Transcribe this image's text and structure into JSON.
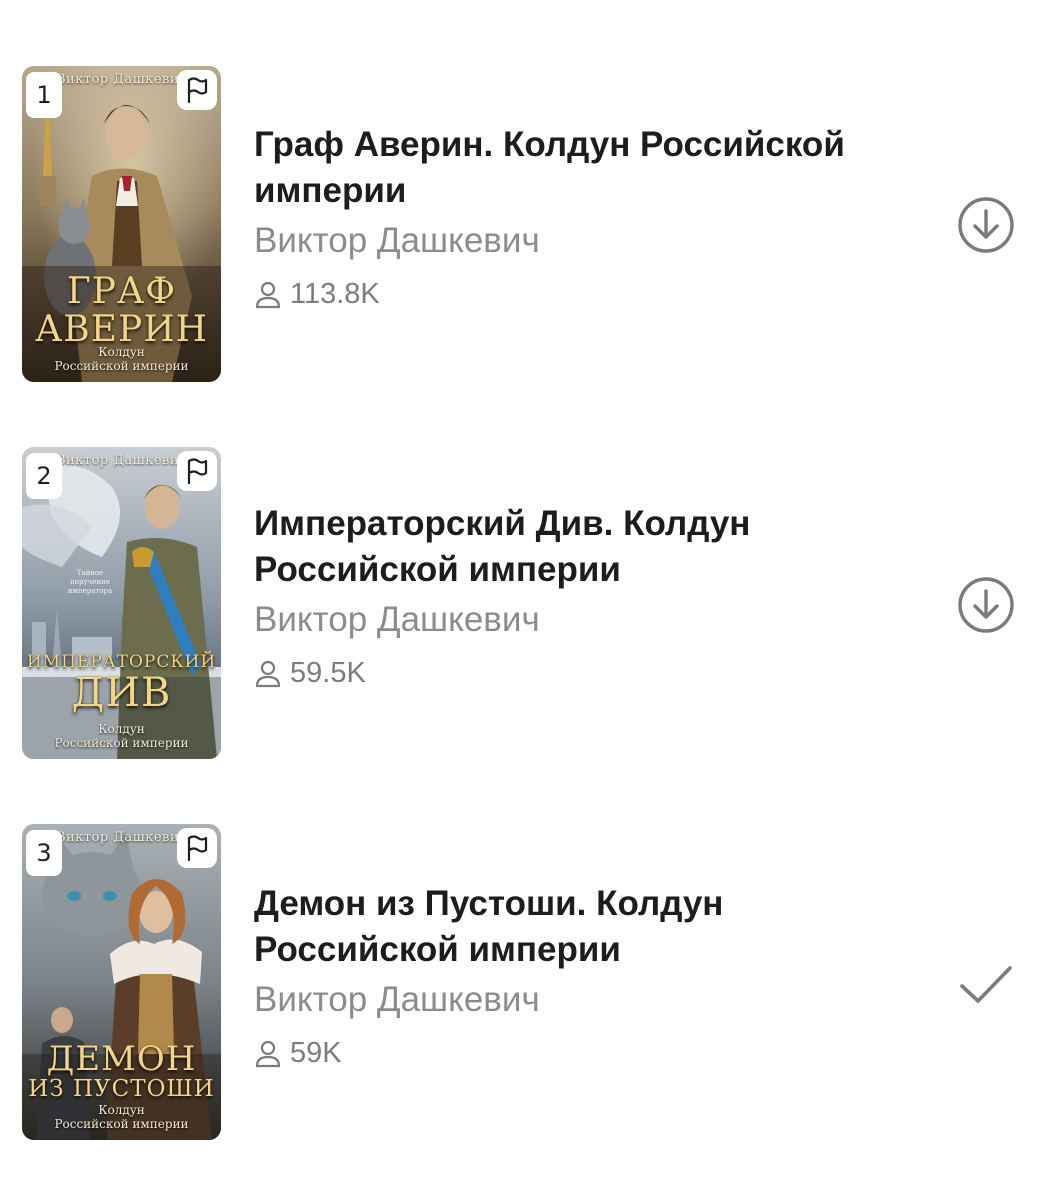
{
  "books": [
    {
      "rank": "1",
      "title": "Граф Аверин. Колдун Российской империи",
      "author": "Виктор Дашкевич",
      "listeners": "113.8K",
      "action_icon": "download-circle-icon",
      "cover": {
        "author": "Виктор Дашкевич",
        "title_line1": "ГРАФ",
        "title_line2": "АВЕРИН",
        "subtitle_line1": "Колдун",
        "subtitle_line2": "Российской империи"
      }
    },
    {
      "rank": "2",
      "title": "Императорский Див. Колдун Российской империи",
      "author": "Виктор Дашкевич",
      "listeners": "59.5K",
      "action_icon": "download-circle-icon",
      "cover": {
        "author": "Виктор Дашкевич",
        "tagline": "Тайное поручение императора",
        "title_line1": "ИМПЕРАТОРСКИЙ",
        "title_line2": "ДИВ",
        "subtitle_line1": "Колдун",
        "subtitle_line2": "Российской империи"
      }
    },
    {
      "rank": "3",
      "title": "Демон из Пустоши. Колдун Российской империи",
      "author": "Виктор Дашкевич",
      "listeners": "59K",
      "action_icon": "checkmark-icon",
      "cover": {
        "author": "Виктор Дашкевич",
        "title_line1": "ДЕМОН",
        "title_line2": "ИЗ ПУСТОШИ",
        "subtitle_line1": "Колдун",
        "subtitle_line2": "Российской империи"
      }
    }
  ],
  "colors": {
    "title": "#1d1d1d",
    "secondary": "#8c8c8c",
    "icon": "#7b7b7b",
    "cover_gold": "#f2d58b"
  }
}
